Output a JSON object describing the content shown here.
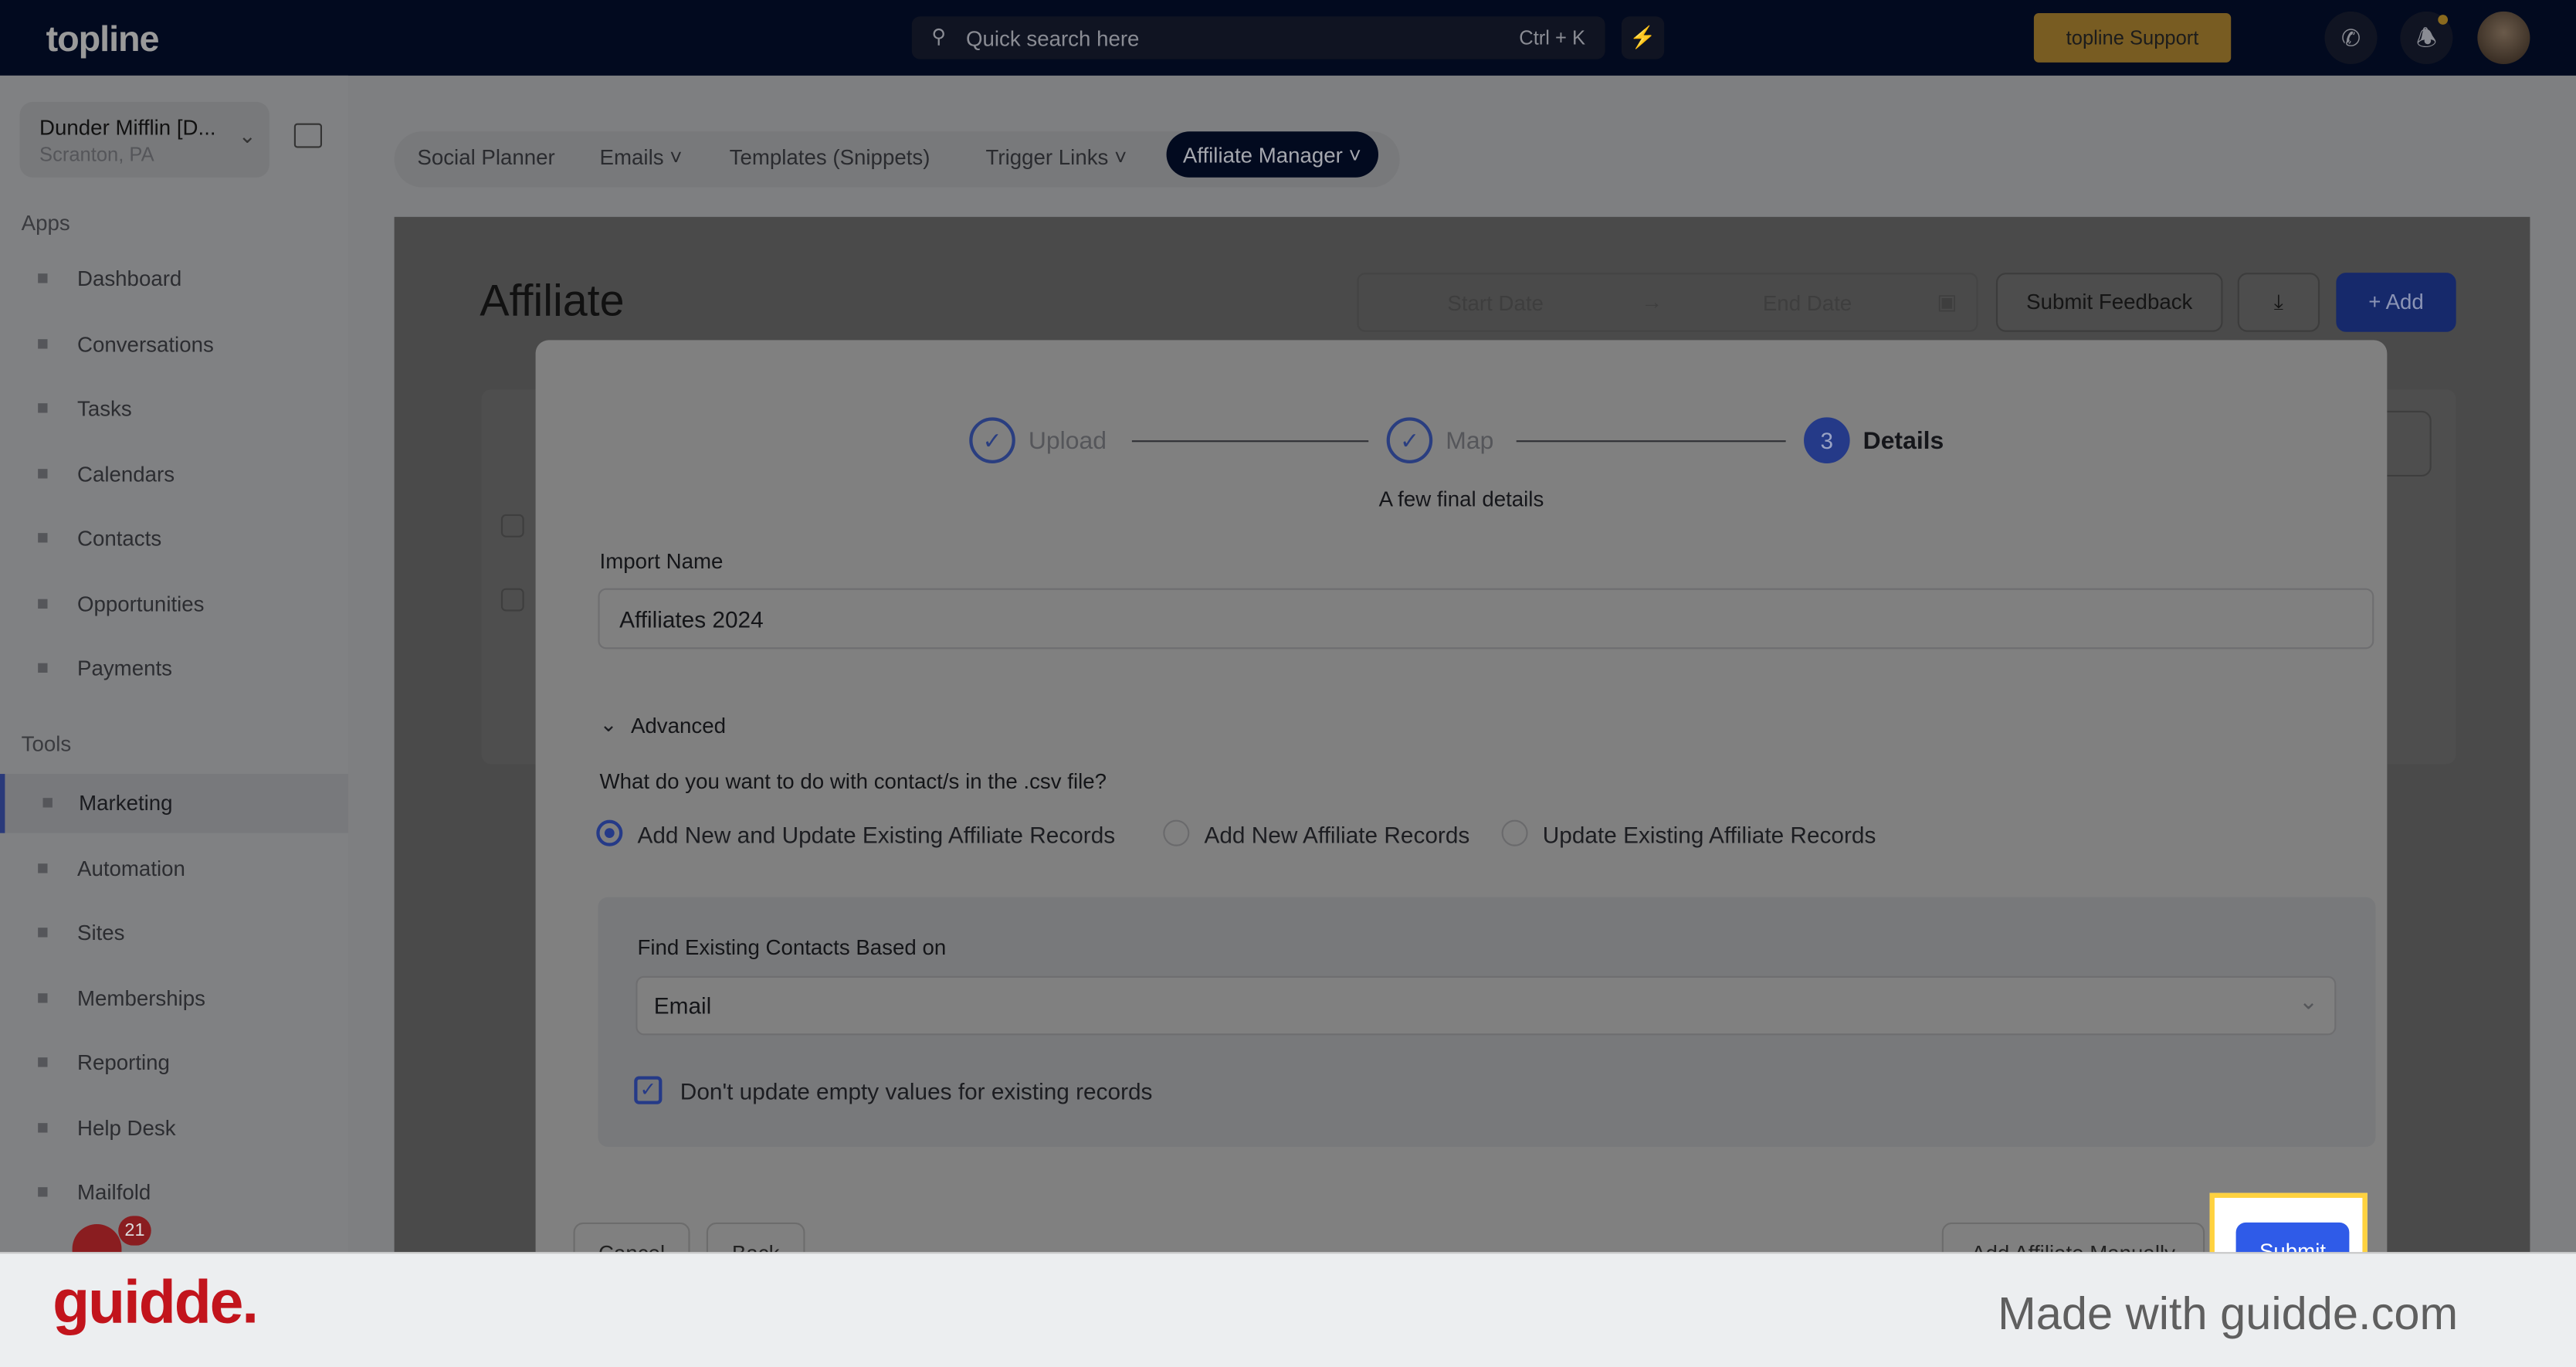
{
  "topbar": {
    "logo": "topline",
    "search_placeholder": "Quick search here",
    "shortcut": "Ctrl + K",
    "support": "topline Support"
  },
  "sidebar": {
    "account_name": "Dunder Mifflin [D...",
    "account_location": "Scranton, PA",
    "apps_heading": "Apps",
    "tools_heading": "Tools",
    "apps": [
      {
        "label": "Dashboard",
        "icon": "dashboard-icon"
      },
      {
        "label": "Conversations",
        "icon": "chat-icon"
      },
      {
        "label": "Tasks",
        "icon": "tasks-icon"
      },
      {
        "label": "Calendars",
        "icon": "calendar-icon"
      },
      {
        "label": "Contacts",
        "icon": "person-icon"
      },
      {
        "label": "Opportunities",
        "icon": "target-icon"
      },
      {
        "label": "Payments",
        "icon": "card-icon"
      }
    ],
    "tools": [
      {
        "label": "Marketing",
        "icon": "megaphone-icon",
        "active": true
      },
      {
        "label": "Automation",
        "icon": "gears-icon"
      },
      {
        "label": "Sites",
        "icon": "globe-icon"
      },
      {
        "label": "Memberships",
        "icon": "people-icon"
      },
      {
        "label": "Reporting",
        "icon": "pie-icon"
      },
      {
        "label": "Help Desk",
        "icon": "help-icon"
      },
      {
        "label": "Mailfold",
        "icon": "mail-icon"
      }
    ],
    "badge_count": "21"
  },
  "tabs": [
    {
      "label": "Social Planner"
    },
    {
      "label": "Emails"
    },
    {
      "label": "Templates (Snippets)"
    },
    {
      "label": "Trigger Links"
    },
    {
      "label": "Affiliate Manager"
    }
  ],
  "page": {
    "title": "Affiliate",
    "start_date": "Start Date",
    "end_date": "End Date",
    "submit_feedback": "Submit Feedback",
    "add": "Add"
  },
  "modal": {
    "steps": [
      {
        "label": "Upload",
        "state": "done"
      },
      {
        "label": "Map",
        "state": "done"
      },
      {
        "number": "3",
        "label": "Details",
        "state": "active"
      }
    ],
    "subtitle": "A few final details",
    "import_name_label": "Import Name",
    "import_name_value": "Affiliates 2024",
    "advanced_label": "Advanced",
    "question": "What do you want to do with contact/s in the .csv file?",
    "options": [
      {
        "label": "Add New and Update Existing Affiliate Records",
        "selected": true
      },
      {
        "label": "Add New Affiliate Records",
        "selected": false
      },
      {
        "label": "Update Existing Affiliate Records",
        "selected": false
      }
    ],
    "find_label": "Find Existing Contacts Based on",
    "find_value": "Email",
    "checkbox_label": "Don't update empty values for existing records",
    "checkbox_checked": true,
    "cancel": "Cancel",
    "back": "Back",
    "add_manually": "Add Affiliate Manually",
    "submit": "Submit"
  },
  "footer": {
    "logo": "guidde.",
    "made_with": "Made with guidde.com"
  },
  "colors": {
    "topbar": "#020a1f",
    "accent": "#2f5be8",
    "highlight": "#ffd23f",
    "guidde": "#c2141c"
  }
}
